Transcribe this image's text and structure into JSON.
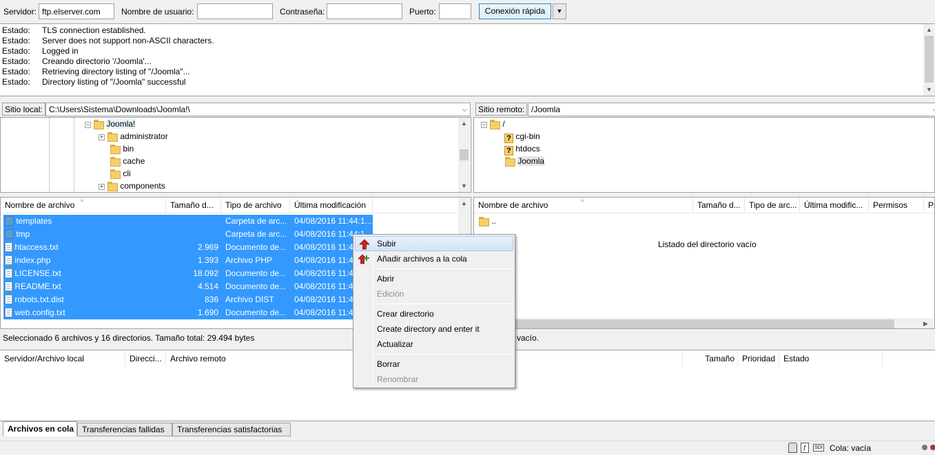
{
  "quickconnect": {
    "server_label": "Servidor:",
    "server_value": "ftp.elserver.com",
    "user_label": "Nombre de usuario:",
    "user_value": "",
    "password_label": "Contraseña:",
    "password_value": "",
    "port_label": "Puerto:",
    "port_value": "",
    "connect_label": "Conexión rápida"
  },
  "log": [
    {
      "k": "Estado:",
      "v": "TLS connection established."
    },
    {
      "k": "Estado:",
      "v": "Server does not support non-ASCII characters."
    },
    {
      "k": "Estado:",
      "v": "Logged in"
    },
    {
      "k": "Estado:",
      "v": "Creando directorio '/Joomla'..."
    },
    {
      "k": "Estado:",
      "v": "Retrieving directory listing of \"/Joomla\"..."
    },
    {
      "k": "Estado:",
      "v": "Directory listing of \"/Joomla\" successful"
    }
  ],
  "local": {
    "site_label": "Sitio local:",
    "site_path": "C:\\Users\\Sistema\\Downloads\\Joomla!\\",
    "tree": [
      "Joomla!",
      "administrator",
      "bin",
      "cache",
      "cli",
      "components"
    ],
    "headers": [
      "Nombre de archivo",
      "Tamaño d...",
      "Tipo de archivo",
      "Última modificación"
    ],
    "files": [
      {
        "name": "templates",
        "size": "",
        "type": "Carpeta de arc...",
        "date": "04/08/2016 11:44:1..."
      },
      {
        "name": "tmp",
        "size": "",
        "type": "Carpeta de arc...",
        "date": "04/08/2016 11:44:1..."
      },
      {
        "name": "htaccess.txt",
        "size": "2.969",
        "type": "Documento de...",
        "date": "04/08/2016 11:44"
      },
      {
        "name": "index.php",
        "size": "1.393",
        "type": "Archivo PHP",
        "date": "04/08/2016 11:44"
      },
      {
        "name": "LICENSE.txt",
        "size": "18.092",
        "type": "Documento de...",
        "date": "04/08/2016 11:44"
      },
      {
        "name": "README.txt",
        "size": "4.514",
        "type": "Documento de...",
        "date": "04/08/2016 11:44"
      },
      {
        "name": "robots.txt.dist",
        "size": "836",
        "type": "Archivo DIST",
        "date": "04/08/2016 11:44"
      },
      {
        "name": "web.config.txt",
        "size": "1.690",
        "type": "Documento de...",
        "date": "04/08/2016 11:44"
      }
    ],
    "status": "Seleccionado 6 archivos y 16 directorios. Tamaño total: 29.494 bytes"
  },
  "remote": {
    "site_label": "Sitio remoto:",
    "site_path": "/Joomla",
    "tree": [
      "/",
      "cgi-bin",
      "htdocs",
      "Joomla"
    ],
    "headers": [
      "Nombre de archivo",
      "Tamaño d...",
      "Tipo de arc...",
      "Última modific...",
      "Permisos",
      "Pr"
    ],
    "parent": "..",
    "empty_msg": "Listado del directorio vacío",
    "status": "vacío."
  },
  "queue": {
    "headers": [
      "Servidor/Archivo local",
      "Direcci...",
      "Archivo remoto",
      "Tamaño",
      "Prioridad",
      "Estado"
    ]
  },
  "tabs": [
    "Archivos en cola",
    "Transferencias fallidas",
    "Transferencias satisfactorias"
  ],
  "statusbar": {
    "queue": "Cola: vacía"
  },
  "context_menu": {
    "items": [
      {
        "label": "Subir",
        "icon": "upload-arrow-icon"
      },
      {
        "label": "Añadir archivos a la cola",
        "icon": "add-to-queue-icon"
      },
      {
        "label": "Abrir"
      },
      {
        "label": "Edición"
      },
      {
        "label": "Crear directorio"
      },
      {
        "label": "Create directory and enter it"
      },
      {
        "label": "Actualizar"
      },
      {
        "label": "Borrar"
      },
      {
        "label": "Renombrar"
      }
    ]
  },
  "colors": {
    "selection": "#3399ff",
    "menu_highlight": "#d2e4f8"
  }
}
